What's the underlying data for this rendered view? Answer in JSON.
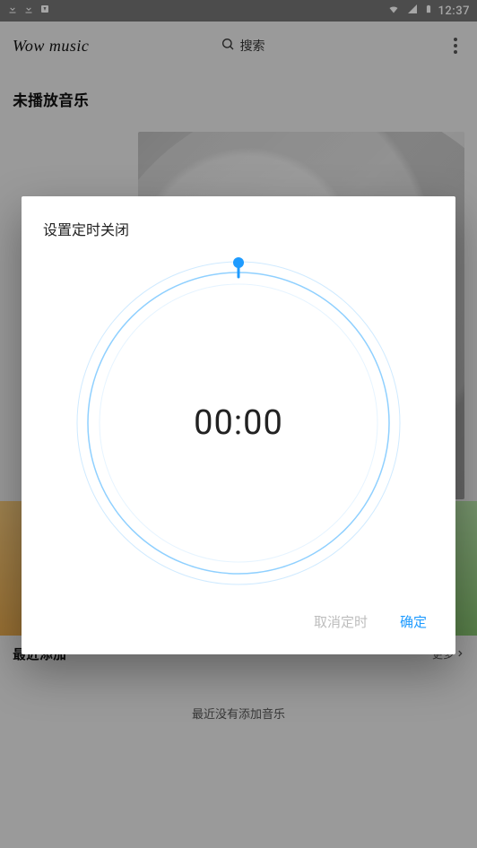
{
  "status_bar": {
    "time": "12:37"
  },
  "app_bar": {
    "title": "Wow music",
    "search_label": "搜索"
  },
  "sections": {
    "not_playing": "未播放音乐",
    "recent_added": "最近添加",
    "more_label": "更多",
    "empty_recent": "最近没有添加音乐"
  },
  "dialog": {
    "title": "设置定时关闭",
    "time_value": "00:00",
    "cancel_label": "取消定时",
    "confirm_label": "确定"
  },
  "chart_data": {
    "type": "other",
    "description": "Circular timer dial",
    "value_minutes": 0,
    "range_minutes": [
      0,
      60
    ],
    "handle_angle_deg": 0,
    "display": "00:00"
  }
}
